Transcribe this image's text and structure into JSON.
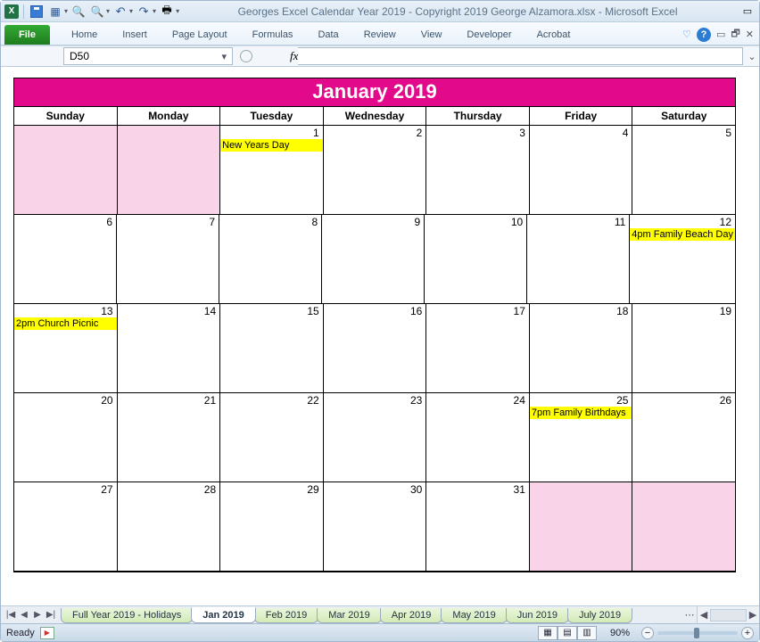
{
  "title": "Georges Excel Calendar Year 2019 - Copyright 2019 George Alzamora.xlsx  -  Microsoft Excel",
  "ribbon": {
    "file": "File",
    "tabs": [
      "Home",
      "Insert",
      "Page Layout",
      "Formulas",
      "Data",
      "Review",
      "View",
      "Developer",
      "Acrobat"
    ]
  },
  "namebox": "D50",
  "fx_label": "fx",
  "formula": "",
  "calendar": {
    "title": "January 2019",
    "day_headers": [
      "Sunday",
      "Monday",
      "Tuesday",
      "Wednesday",
      "Thursday",
      "Friday",
      "Saturday"
    ],
    "weeks": [
      [
        {
          "day": "",
          "pink": true
        },
        {
          "day": "",
          "pink": true
        },
        {
          "day": "1",
          "event": "New Years Day"
        },
        {
          "day": "2"
        },
        {
          "day": "3"
        },
        {
          "day": "4"
        },
        {
          "day": "5"
        }
      ],
      [
        {
          "day": "6"
        },
        {
          "day": "7"
        },
        {
          "day": "8"
        },
        {
          "day": "9"
        },
        {
          "day": "10"
        },
        {
          "day": "11"
        },
        {
          "day": "12",
          "event": "4pm Family Beach Day"
        }
      ],
      [
        {
          "day": "13",
          "event": "2pm Church Picnic"
        },
        {
          "day": "14"
        },
        {
          "day": "15"
        },
        {
          "day": "16"
        },
        {
          "day": "17"
        },
        {
          "day": "18"
        },
        {
          "day": "19"
        }
      ],
      [
        {
          "day": "20"
        },
        {
          "day": "21"
        },
        {
          "day": "22"
        },
        {
          "day": "23"
        },
        {
          "day": "24"
        },
        {
          "day": "25",
          "event": "7pm Family Birthdays"
        },
        {
          "day": "26"
        }
      ],
      [
        {
          "day": "27"
        },
        {
          "day": "28"
        },
        {
          "day": "29"
        },
        {
          "day": "30"
        },
        {
          "day": "31"
        },
        {
          "day": "",
          "pink": true
        },
        {
          "day": "",
          "pink": true
        }
      ]
    ]
  },
  "sheet_tabs": {
    "items": [
      "Full Year 2019 - Holidays",
      "Jan 2019",
      "Feb 2019",
      "Mar 2019",
      "Apr 2019",
      "May 2019",
      "Jun 2019",
      "July 2019"
    ],
    "active_index": 1
  },
  "statusbar": {
    "ready": "Ready",
    "zoom": "90%"
  }
}
